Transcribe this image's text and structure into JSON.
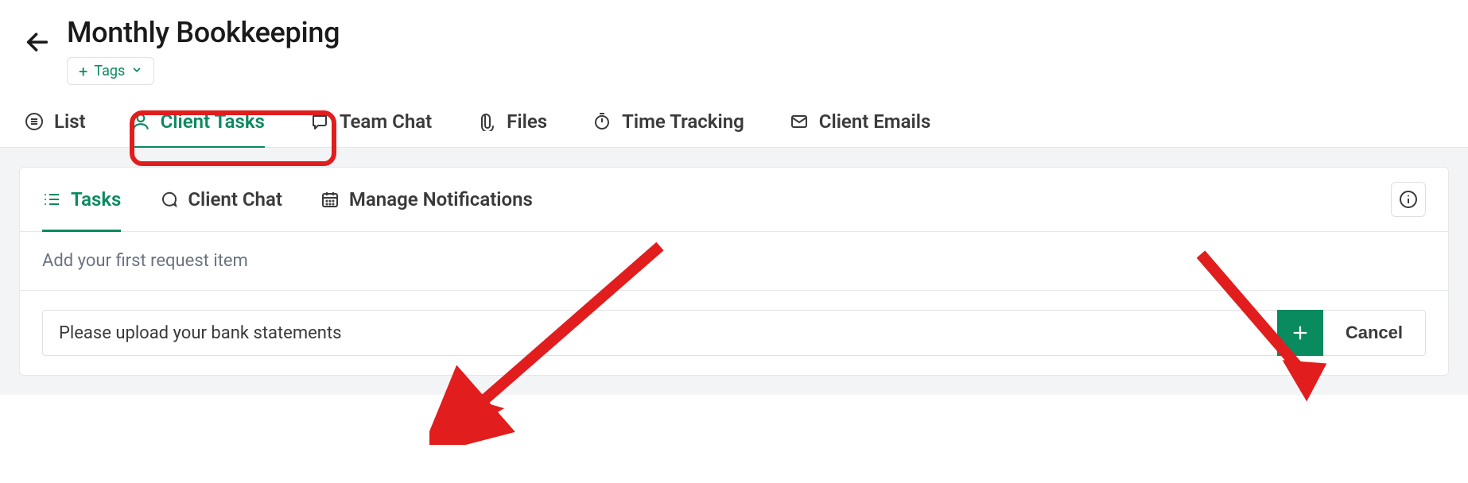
{
  "page_title": "Monthly Bookkeeping",
  "tags_button": {
    "label": "Tags"
  },
  "main_tabs": [
    {
      "id": "list",
      "label": "List",
      "icon": "list",
      "active": false
    },
    {
      "id": "client-tasks",
      "label": "Client Tasks",
      "icon": "person",
      "active": true
    },
    {
      "id": "team-chat",
      "label": "Team Chat",
      "icon": "chat",
      "active": false
    },
    {
      "id": "files",
      "label": "Files",
      "icon": "attachment",
      "active": false
    },
    {
      "id": "time-tracking",
      "label": "Time Tracking",
      "icon": "timer",
      "active": false
    },
    {
      "id": "client-emails",
      "label": "Client Emails",
      "icon": "mail",
      "active": false
    }
  ],
  "sub_tabs": [
    {
      "id": "tasks",
      "label": "Tasks",
      "icon": "checklist",
      "active": true
    },
    {
      "id": "client-chat",
      "label": "Client Chat",
      "icon": "chat-bubble",
      "active": false
    },
    {
      "id": "manage-notifications",
      "label": "Manage Notifications",
      "icon": "calendar",
      "active": false
    }
  ],
  "request_section": {
    "header": "Add your first request item",
    "input_value": "Please upload your bank statements",
    "cancel_label": "Cancel"
  },
  "colors": {
    "accent": "#0a8a5f",
    "highlight": "#e11d1d"
  },
  "annotations": {
    "highlighted_tab": "client-tasks",
    "arrows": [
      {
        "from": "sub-tab-area",
        "to": "request-input"
      },
      {
        "from": "top-right",
        "to": "add-button"
      }
    ]
  }
}
